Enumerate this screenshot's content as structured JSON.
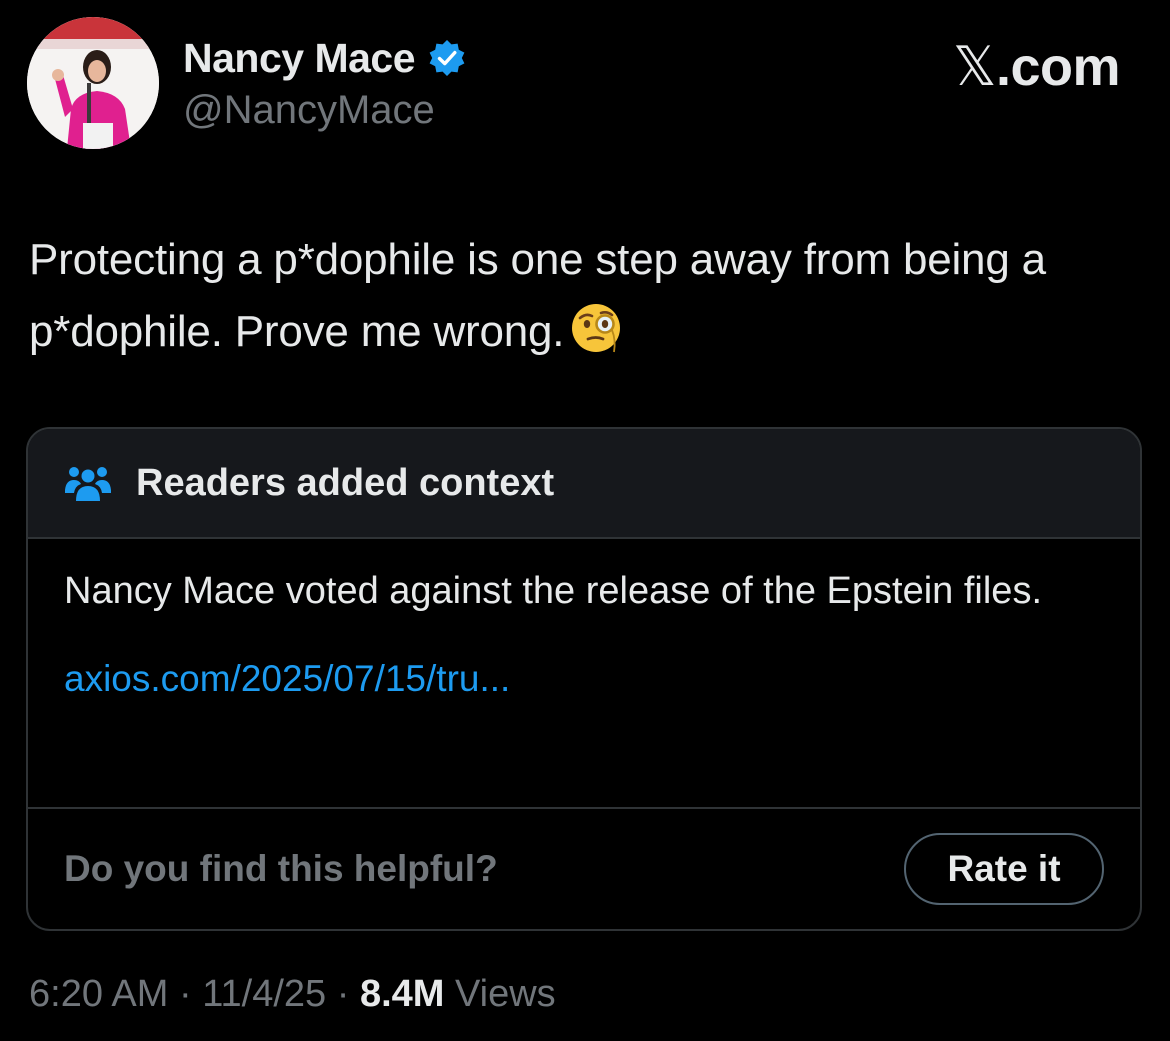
{
  "author": {
    "name": "Nancy Mace",
    "handle": "@NancyMace",
    "verified": true
  },
  "brand": {
    "glyph": "𝕏",
    "suffix": ".com"
  },
  "tweet": {
    "text": "Protecting a p*dophile is one step away from being a p*dophile. Prove me wrong.",
    "emoji": "face-with-monocle-emoji"
  },
  "community_note": {
    "title": "Readers added context",
    "body": "Nancy Mace voted against the release of the Epstein files.",
    "link": "axios.com/2025/07/15/tru...",
    "helpful_question": "Do you find this helpful?",
    "rate_label": "Rate it"
  },
  "meta": {
    "time": "6:20 AM",
    "separator": "·",
    "date": "11/4/25",
    "views_count": "8.4M",
    "views_label": "Views"
  },
  "colors": {
    "background": "#000000",
    "text": "#e7e9ea",
    "muted": "#71767b",
    "link": "#1d9bf0",
    "verified": "#1d9bf0",
    "border": "#2f3336"
  }
}
